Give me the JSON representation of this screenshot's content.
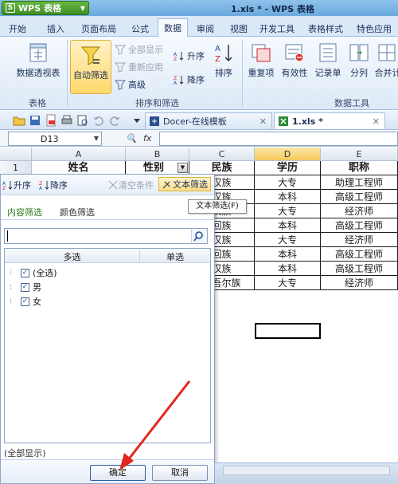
{
  "app": {
    "menu_label": "WPS 表格",
    "window_title": "1.xls * - WPS 表格"
  },
  "ribbon_tabs": [
    "开始",
    "插入",
    "页面布局",
    "公式",
    "数据",
    "审阅",
    "视图",
    "开发工具",
    "表格样式",
    "特色应用"
  ],
  "ribbon": {
    "pivot": "数据透视表",
    "autofilter": "自动筛选",
    "show_all": "全部显示",
    "reapply": "重新应用",
    "advanced": "高级",
    "sort_asc": "升序",
    "sort_desc": "降序",
    "sort": "排序",
    "duplicates": "重复项",
    "validity": "有效性",
    "records": "记录单",
    "split": "分列",
    "merge": "合并计",
    "group_table": "表格",
    "group_sort_filter": "排序和筛选",
    "group_data_tools": "数据工具"
  },
  "doc_tabs": [
    {
      "label": "Docer-在线模板"
    },
    {
      "label": "1.xls *"
    }
  ],
  "formula_bar": {
    "cell_ref": "D13",
    "fx": "fx",
    "value": ""
  },
  "sheet": {
    "columns": [
      "A",
      "B",
      "C",
      "D",
      "E"
    ],
    "row1_number": "1",
    "headers": [
      "姓名",
      "性别",
      "民族",
      "学历",
      "职称"
    ],
    "visible_rows": [
      [
        "汉族",
        "大专",
        "助理工程师"
      ],
      [
        "汉族",
        "本科",
        "高级工程师"
      ],
      [
        "汉族",
        "大专",
        "经济师"
      ],
      [
        "回族",
        "本科",
        "高级工程师"
      ],
      [
        "汉族",
        "大专",
        "经济师"
      ],
      [
        "回族",
        "本科",
        "高级工程师"
      ],
      [
        "汉族",
        "本科",
        "高级工程师"
      ],
      [
        "维吾尔族",
        "大专",
        "经济师"
      ]
    ]
  },
  "filter_panel": {
    "sort_asc": "升序",
    "sort_desc": "降序",
    "clear": "清空条件",
    "text_filter": "文本筛选",
    "tab_content": "内容筛选",
    "tab_color": "颜色筛选",
    "search_value": "",
    "col_multi": "多选",
    "col_single": "单选",
    "items": [
      {
        "label": "(全选)",
        "checked": true
      },
      {
        "label": "男",
        "checked": true
      },
      {
        "label": "女",
        "checked": true
      }
    ],
    "status": "(全部显示)",
    "ok": "确定",
    "cancel": "取消"
  },
  "tooltip": "文本筛选(F)"
}
